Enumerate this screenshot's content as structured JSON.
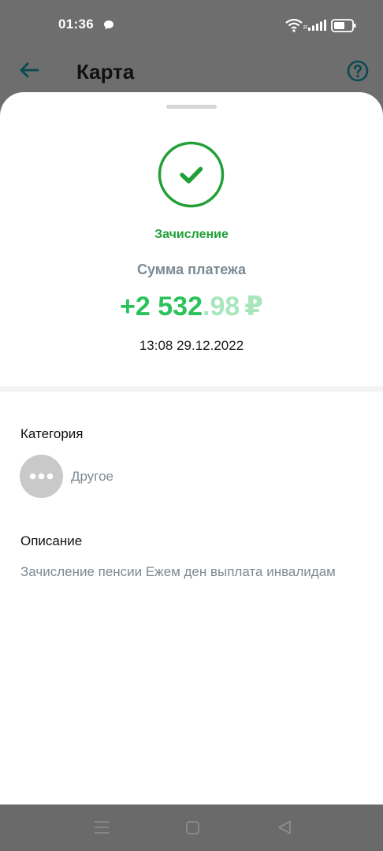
{
  "status_bar": {
    "time": "01:36",
    "roaming": "R",
    "icons": [
      "message-icon",
      "wifi-icon",
      "signal-icon",
      "battery-icon"
    ]
  },
  "header": {
    "title": "Карта",
    "icons": [
      "back-arrow-icon",
      "help-icon"
    ]
  },
  "transaction": {
    "type": "Зачисление",
    "amount_label": "Сумма платежа",
    "amount_main": "+2 532",
    "amount_fraction": ".98",
    "currency": "₽",
    "datetime": "13:08 29.12.2022",
    "status_icon": "check-circle-icon"
  },
  "category": {
    "title": "Категория",
    "value": "Другое",
    "icon": "more-dots-icon"
  },
  "description": {
    "title": "Описание",
    "text": "Зачисление пенсии Ежем ден выплата инвалидам"
  },
  "nav": {
    "icons": [
      "menu-icon",
      "home-icon",
      "back-icon"
    ]
  },
  "colors": {
    "accent_green": "#21a038",
    "amount_green": "#2bc25a",
    "amount_light_green": "#a8e6bb",
    "muted_text": "#7d8a93",
    "overlay_gray": "#6e6e6e"
  }
}
